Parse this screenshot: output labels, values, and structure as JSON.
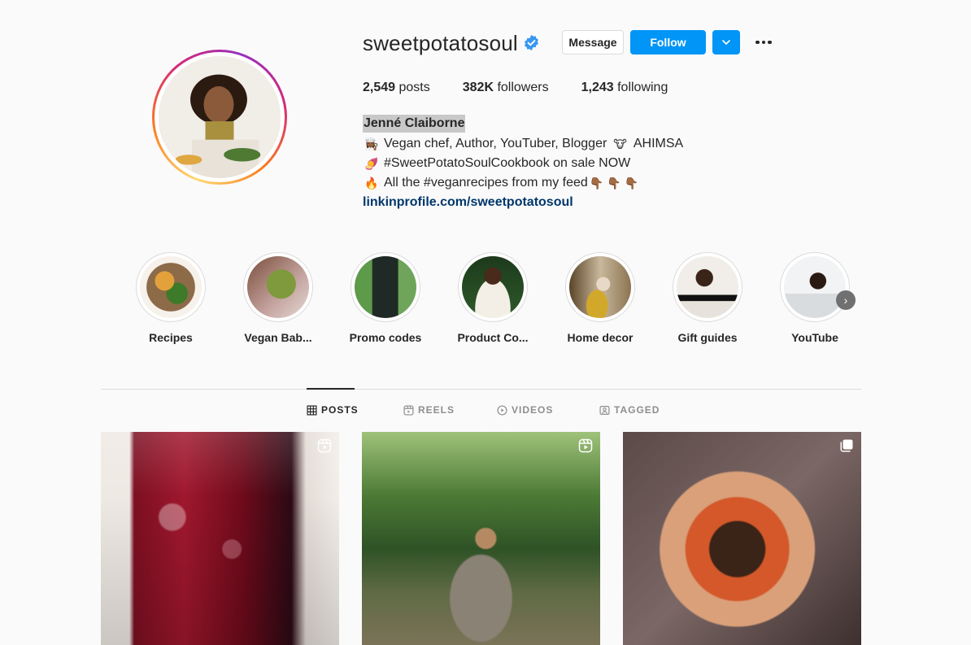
{
  "profile": {
    "username": "sweetpotatosoul",
    "verified": true,
    "buttons": {
      "message": "Message",
      "follow": "Follow"
    },
    "stats": {
      "posts_value": "2,549",
      "posts_label": "posts",
      "followers_value": "382K",
      "followers_label": "followers",
      "following_value": "1,243",
      "following_label": "following"
    },
    "full_name": "Jenné Claiborne",
    "bio": {
      "line1": "Vegan chef, Author, YouTuber, Blogger",
      "line1_suffix": "AHIMSA",
      "line2": "#SweetPotatoSoulCookbook on sale NOW",
      "line3": "All the #veganrecipes from my feed",
      "link": "linkinprofile.com/sweetpotatosoul"
    }
  },
  "highlights": [
    {
      "label": "Recipes"
    },
    {
      "label": "Vegan Bab..."
    },
    {
      "label": "Promo codes"
    },
    {
      "label": "Product Co..."
    },
    {
      "label": "Home decor"
    },
    {
      "label": "Gift guides"
    },
    {
      "label": "YouTube"
    }
  ],
  "tabs": {
    "posts": "POSTS",
    "reels": "REELS",
    "videos": "VIDEOS",
    "tagged": "TAGGED"
  },
  "colors": {
    "accent": "#0095f6",
    "link": "#00376b",
    "verified": "#3897f0"
  }
}
